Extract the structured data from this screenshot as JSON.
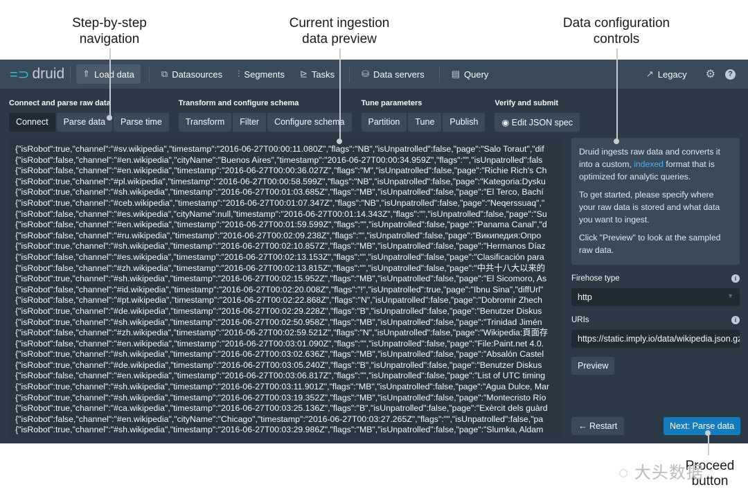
{
  "annotations": {
    "nav": [
      "Step-by-step",
      "navigation"
    ],
    "preview": [
      "Current ingestion",
      "data preview"
    ],
    "controls": [
      "Data configuration",
      "controls"
    ],
    "next": [
      "Proceed",
      "button"
    ]
  },
  "watermark": "大头数据",
  "nav": {
    "logo": "druid",
    "items": [
      {
        "label": "Load data",
        "icon": "upload-icon"
      },
      {
        "label": "Datasources",
        "icon": "datasources-icon"
      },
      {
        "label": "Segments",
        "icon": "segments-icon"
      },
      {
        "label": "Tasks",
        "icon": "tasks-icon"
      },
      {
        "label": "Data servers",
        "icon": "database-icon"
      },
      {
        "label": "Query",
        "icon": "query-icon"
      }
    ],
    "legacy": "Legacy"
  },
  "stages": [
    {
      "title": "Connect and parse raw data",
      "steps": [
        "Connect",
        "Parse data",
        "Parse time"
      ],
      "active": "Connect"
    },
    {
      "title": "Transform and configure schema",
      "steps": [
        "Transform",
        "Filter",
        "Configure schema"
      ]
    },
    {
      "title": "Tune parameters",
      "steps": [
        "Partition",
        "Tune",
        "Publish"
      ]
    },
    {
      "title": "Verify and submit",
      "steps": [
        "Edit JSON spec"
      ]
    }
  ],
  "preview_rows": [
    "{\"isRobot\":true,\"channel\":\"#sv.wikipedia\",\"timestamp\":\"2016-06-27T00:00:11.080Z\",\"flags\":\"NB\",\"isUnpatrolled\":false,\"page\":\"Salo Toraut\",\"dif",
    "{\"isRobot\":false,\"channel\":\"#en.wikipedia\",\"cityName\":\"Buenos Aires\",\"timestamp\":\"2016-06-27T00:00:34.959Z\",\"flags\":\"\",\"isUnpatrolled\":fals",
    "{\"isRobot\":false,\"channel\":\"#en.wikipedia\",\"timestamp\":\"2016-06-27T00:00:36.027Z\",\"flags\":\"M\",\"isUnpatrolled\":false,\"page\":\"Richie Rich's Ch",
    "{\"isRobot\":true,\"channel\":\"#pl.wikipedia\",\"timestamp\":\"2016-06-27T00:00:58.599Z\",\"flags\":\"NB\",\"isUnpatrolled\":false,\"page\":\"Kategoria:Dysku",
    "{\"isRobot\":true,\"channel\":\"#sh.wikipedia\",\"timestamp\":\"2016-06-27T00:01:03.685Z\",\"flags\":\"MB\",\"isUnpatrolled\":false,\"page\":\"El Terco, Bachí",
    "{\"isRobot\":true,\"channel\":\"#ceb.wikipedia\",\"timestamp\":\"2016-06-27T00:01:07.347Z\",\"flags\":\"NB\",\"isUnpatrolled\":false,\"page\":\"Neqerssuaq\",\"",
    "{\"isRobot\":false,\"channel\":\"#es.wikipedia\",\"cityName\":null,\"timestamp\":\"2016-06-27T00:01:14.343Z\",\"flags\":\"\",\"isUnpatrolled\":false,\"page\":\"Su",
    "{\"isRobot\":false,\"channel\":\"#en.wikipedia\",\"timestamp\":\"2016-06-27T00:01:59.599Z\",\"flags\":\"\",\"isUnpatrolled\":false,\"page\":\"Panama Canal\",\"d",
    "{\"isRobot\":false,\"channel\":\"#ru.wikipedia\",\"timestamp\":\"2016-06-27T00:02:09.238Z\",\"flags\":\"\",\"isUnpatrolled\":false,\"page\":\"Википедия:Опро",
    "{\"isRobot\":true,\"channel\":\"#sh.wikipedia\",\"timestamp\":\"2016-06-27T00:02:10.857Z\",\"flags\":\"MB\",\"isUnpatrolled\":false,\"page\":\"Hermanos Díaz",
    "{\"isRobot\":false,\"channel\":\"#es.wikipedia\",\"timestamp\":\"2016-06-27T00:02:13.153Z\",\"flags\":\"\",\"isUnpatrolled\":false,\"page\":\"Clasificación para",
    "{\"isRobot\":false,\"channel\":\"#zh.wikipedia\",\"timestamp\":\"2016-06-27T00:02:13.815Z\",\"flags\":\"\",\"isUnpatrolled\":false,\"page\":\"中共十八大以来的",
    "{\"isRobot\":true,\"channel\":\"#sh.wikipedia\",\"timestamp\":\"2016-06-27T00:02:15.952Z\",\"flags\":\"MB\",\"isUnpatrolled\":false,\"page\":\"El Sicomoro, As",
    "{\"isRobot\":false,\"channel\":\"#id.wikipedia\",\"timestamp\":\"2016-06-27T00:02:20.008Z\",\"flags\":\"!\",\"isUnpatrolled\":true,\"page\":\"Ibnu Sina\",\"diffUrl\"",
    "{\"isRobot\":false,\"channel\":\"#pt.wikipedia\",\"timestamp\":\"2016-06-27T00:02:22.868Z\",\"flags\":\"N\",\"isUnpatrolled\":false,\"page\":\"Dobromir Zhech",
    "{\"isRobot\":true,\"channel\":\"#de.wikipedia\",\"timestamp\":\"2016-06-27T00:02:29.228Z\",\"flags\":\"B\",\"isUnpatrolled\":false,\"page\":\"Benutzer Diskus",
    "{\"isRobot\":true,\"channel\":\"#sh.wikipedia\",\"timestamp\":\"2016-06-27T00:02:50.958Z\",\"flags\":\"MB\",\"isUnpatrolled\":false,\"page\":\"Trinidad Jimén",
    "{\"isRobot\":false,\"channel\":\"#zh.wikipedia\",\"timestamp\":\"2016-06-27T00:02:59.521Z\",\"flags\":\"N\",\"isUnpatrolled\":false,\"page\":\"Wikipedia:頁面存",
    "{\"isRobot\":false,\"channel\":\"#en.wikipedia\",\"timestamp\":\"2016-06-27T00:03:01.090Z\",\"flags\":\"\",\"isUnpatrolled\":false,\"page\":\"File:Paint.net 4.0.",
    "{\"isRobot\":true,\"channel\":\"#sh.wikipedia\",\"timestamp\":\"2016-06-27T00:03:02.636Z\",\"flags\":\"MB\",\"isUnpatrolled\":false,\"page\":\"Absalón Castel",
    "{\"isRobot\":true,\"channel\":\"#de.wikipedia\",\"timestamp\":\"2016-06-27T00:03:05.240Z\",\"flags\":\"B\",\"isUnpatrolled\":false,\"page\":\"Benutzer Diskus",
    "{\"isRobot\":false,\"channel\":\"#en.wikipedia\",\"timestamp\":\"2016-06-27T00:03:06.817Z\",\"flags\":\"\",\"isUnpatrolled\":false,\"page\":\"List of UTC timing",
    "{\"isRobot\":true,\"channel\":\"#sh.wikipedia\",\"timestamp\":\"2016-06-27T00:03:11.901Z\",\"flags\":\"MB\",\"isUnpatrolled\":false,\"page\":\"Agua Dulce, Mar",
    "{\"isRobot\":true,\"channel\":\"#sh.wikipedia\",\"timestamp\":\"2016-06-27T00:03:19.352Z\",\"flags\":\"MB\",\"isUnpatrolled\":false,\"page\":\"Montecristo Río",
    "{\"isRobot\":true,\"channel\":\"#ca.wikipedia\",\"timestamp\":\"2016-06-27T00:03:25.136Z\",\"flags\":\"B\",\"isUnpatrolled\":false,\"page\":\"Exèrcit dels guàrd",
    "{\"isRobot\":false,\"channel\":\"#en.wikipedia\",\"cityName\":\"Chicago\",\"timestamp\":\"2016-06-27T00:03:27.265Z\",\"flags\":\"\",\"isUnpatrolled\":false,\"pa",
    "{\"isRobot\":true,\"channel\":\"#sh.wikipedia\",\"timestamp\":\"2016-06-27T00:03:29.986Z\",\"flags\":\"MB\",\"isUnpatrolled\":false,\"page\":\"Slumka, Aldam"
  ],
  "side": {
    "intro_1a": "Druid ingests raw data and converts it into a custom, ",
    "intro_link": "indexed",
    "intro_1b": " format that is optimized for analytic queries.",
    "intro_2": "To get started, please specify where your raw data is stored and what data you want to ingest.",
    "intro_3": "Click \"Preview\" to look at the sampled raw data.",
    "firehose_label": "Firehose type",
    "firehose_value": "http",
    "uris_label": "URIs",
    "uris_value": "https://static.imply.io/data/wikipedia.json.gz",
    "preview_button": "Preview"
  },
  "footer": {
    "restart": "Restart",
    "next": "Next: Parse data"
  },
  "colors": {
    "accent": "#137cbd",
    "link": "#48aff0",
    "nav_bg": "#394b59",
    "body_bg": "#2b3a46"
  }
}
